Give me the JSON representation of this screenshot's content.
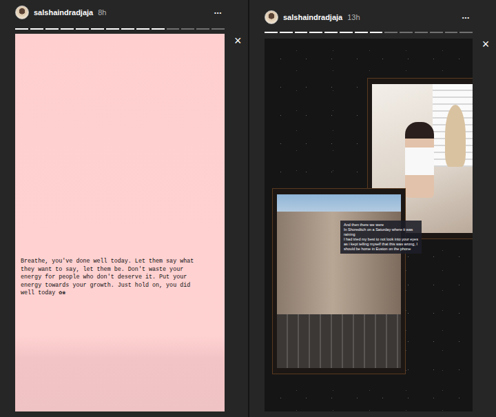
{
  "stories": [
    {
      "username": "salshaindradjaja",
      "time": "8h",
      "menu": "•••",
      "close": "×",
      "kind": "text",
      "segments": [
        {
          "viewed": true
        },
        {
          "viewed": true
        },
        {
          "viewed": true
        },
        {
          "viewed": true
        },
        {
          "viewed": true
        },
        {
          "viewed": true
        },
        {
          "viewed": true
        },
        {
          "viewed": true
        },
        {
          "viewed": true
        },
        {
          "viewed": true
        },
        {
          "viewed": false
        },
        {
          "viewed": false
        },
        {
          "viewed": false
        },
        {
          "viewed": false
        }
      ],
      "text": "Breathe, you've done well today. Let them say what they want to say, let them be. Don't waste your energy for people who don't deserve it. Put your energy towards your growth. Just hold on, you did well today ✿❀",
      "caption": []
    },
    {
      "username": "salshaindradjaja",
      "time": "13h",
      "menu": "•••",
      "close": "×",
      "kind": "collage",
      "segments": [
        {
          "viewed": true
        },
        {
          "viewed": true
        },
        {
          "viewed": true
        },
        {
          "viewed": true
        },
        {
          "viewed": true
        },
        {
          "viewed": true
        },
        {
          "viewed": true
        },
        {
          "viewed": true
        },
        {
          "viewed": false
        },
        {
          "viewed": false
        },
        {
          "viewed": false
        },
        {
          "viewed": false
        },
        {
          "viewed": false
        },
        {
          "viewed": false
        }
      ],
      "text": "",
      "caption": [
        "And then there we were",
        "In Shoreditch on a Saturday where it was",
        "raining",
        "I had tried my best to not look into your eyes",
        "as i kept telling myself that this was wrong, I",
        "should be home in Euston on the phone"
      ]
    }
  ]
}
